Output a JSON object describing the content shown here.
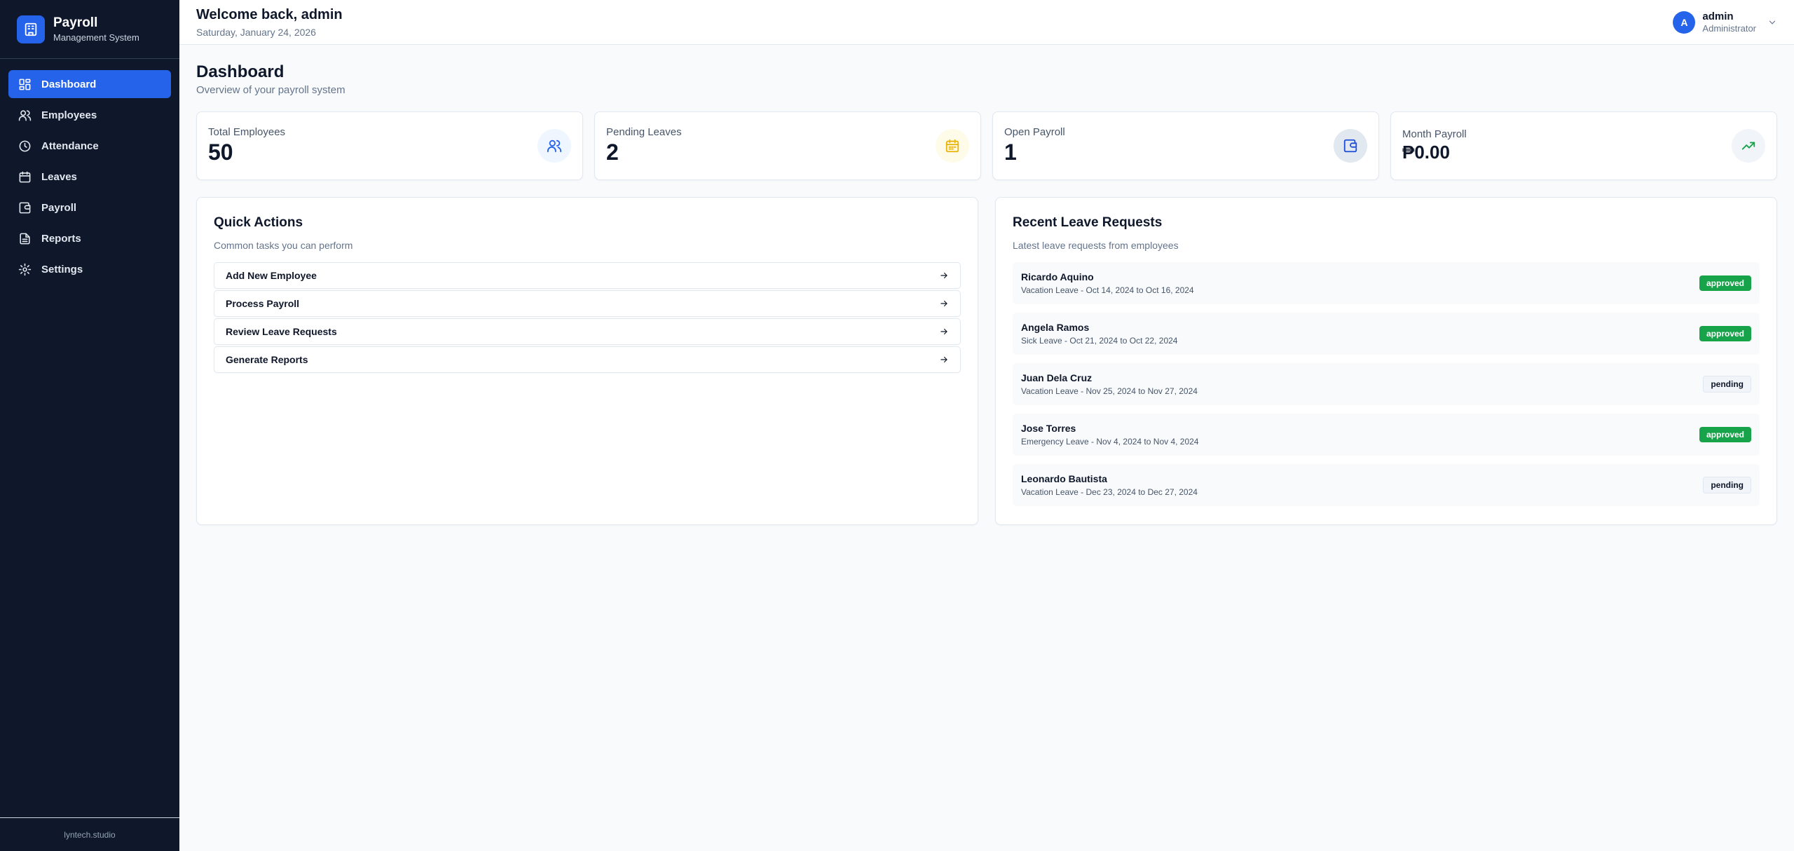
{
  "brand": {
    "title": "Payroll",
    "subtitle": "Management System",
    "accent": "#2563eb"
  },
  "sidebar": {
    "items": [
      {
        "label": "Dashboard",
        "icon": "dashboard-icon",
        "active": true
      },
      {
        "label": "Employees",
        "icon": "users-icon",
        "active": false
      },
      {
        "label": "Attendance",
        "icon": "clock-icon",
        "active": false
      },
      {
        "label": "Leaves",
        "icon": "calendar-icon",
        "active": false
      },
      {
        "label": "Payroll",
        "icon": "wallet-icon",
        "active": false
      },
      {
        "label": "Reports",
        "icon": "file-text-icon",
        "active": false
      },
      {
        "label": "Settings",
        "icon": "gear-icon",
        "active": false
      }
    ],
    "footer": "lyntech.studio"
  },
  "header": {
    "welcome": "Welcome back, admin",
    "date": "Saturday, January 24, 2026",
    "user": {
      "initial": "A",
      "name": "admin",
      "role": "Administrator"
    }
  },
  "page": {
    "title": "Dashboard",
    "subtitle": "Overview of your payroll system"
  },
  "stats": [
    {
      "label": "Total Employees",
      "value": "50",
      "icon": "users-icon",
      "color": "#2563eb"
    },
    {
      "label": "Pending Leaves",
      "value": "2",
      "icon": "calendar-icon",
      "color": "#eab308"
    },
    {
      "label": "Open Payroll",
      "value": "1",
      "icon": "wallet-icon",
      "color": "#1d4ed8"
    },
    {
      "label": "Month Payroll",
      "value": "₱0.00",
      "icon": "trending-up-icon",
      "color": "#16a34a"
    }
  ],
  "quick_actions": {
    "title": "Quick Actions",
    "subtitle": "Common tasks you can perform",
    "items": [
      {
        "label": "Add New Employee"
      },
      {
        "label": "Process Payroll"
      },
      {
        "label": "Review Leave Requests"
      },
      {
        "label": "Generate Reports"
      }
    ]
  },
  "recent_leaves": {
    "title": "Recent Leave Requests",
    "subtitle": "Latest leave requests from employees",
    "items": [
      {
        "name": "Ricardo Aquino",
        "detail": "Vacation Leave - Oct 14, 2024 to Oct 16, 2024",
        "status": "approved"
      },
      {
        "name": "Angela Ramos",
        "detail": "Sick Leave - Oct 21, 2024 to Oct 22, 2024",
        "status": "approved"
      },
      {
        "name": "Juan Dela Cruz",
        "detail": "Vacation Leave - Nov 25, 2024 to Nov 27, 2024",
        "status": "pending"
      },
      {
        "name": "Jose Torres",
        "detail": "Emergency Leave - Nov 4, 2024 to Nov 4, 2024",
        "status": "approved"
      },
      {
        "name": "Leonardo Bautista",
        "detail": "Vacation Leave - Dec 23, 2024 to Dec 27, 2024",
        "status": "pending"
      }
    ]
  }
}
